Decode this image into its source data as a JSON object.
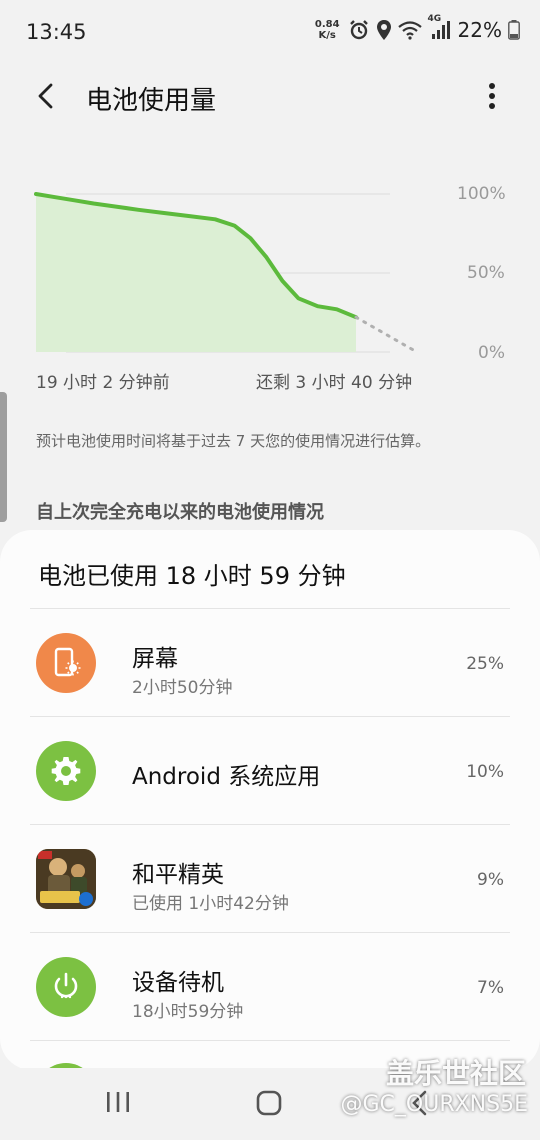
{
  "status_bar": {
    "time": "13:45",
    "net_speed_value": "0.84",
    "net_speed_unit": "K/s",
    "network_type": "4G",
    "battery": "22%",
    "icons": [
      "alarm-icon",
      "location-icon",
      "wifi-icon",
      "signal-icon",
      "battery-icon"
    ]
  },
  "header": {
    "title": "电池使用量",
    "back_icon": "chevron-left-icon",
    "more_icon": "more-vertical-icon"
  },
  "battery_chart": {
    "type": "area",
    "ticks": [
      "100%",
      "50%",
      "0%"
    ],
    "ylim": [
      0,
      100
    ],
    "x_start_label": "19 小时 2 分钟前",
    "x_end_label": "还剩 3 小时 40 分钟",
    "line_color": "#5cba3c",
    "fill_color": "#dcefd4",
    "history": [
      [
        0,
        100
      ],
      [
        0.06,
        98
      ],
      [
        0.12,
        96
      ],
      [
        0.18,
        94
      ],
      [
        0.25,
        92
      ],
      [
        0.32,
        90
      ],
      [
        0.4,
        88
      ],
      [
        0.48,
        86
      ],
      [
        0.56,
        84
      ],
      [
        0.62,
        80
      ],
      [
        0.67,
        72
      ],
      [
        0.72,
        60
      ],
      [
        0.77,
        45
      ],
      [
        0.82,
        34
      ],
      [
        0.88,
        29
      ],
      [
        0.94,
        27
      ],
      [
        1.0,
        22
      ]
    ],
    "projection": [
      [
        1.0,
        22
      ],
      [
        1.19,
        0
      ]
    ]
  },
  "estimate_note": "预计电池使用时间将基于过去 7 天您的使用情况进行估算。",
  "section_header": "自上次完全充电以来的电池使用情况",
  "usage": {
    "summary": "电池已使用 18 小时 59 分钟",
    "apps": [
      {
        "name": "屏幕",
        "detail": "2小时50分钟",
        "percent": "25%",
        "icon": "screen-brightness-icon",
        "color": "#f0884a"
      },
      {
        "name": "Android 系统应用",
        "detail": "",
        "percent": "10%",
        "icon": "gear-icon",
        "color": "#7cc142"
      },
      {
        "name": "和平精英",
        "detail": "已使用 1小时42分钟",
        "percent": "9%",
        "icon": "game-app-icon",
        "color": "#7a5a2a"
      },
      {
        "name": "设备待机",
        "detail": "18小时59分钟",
        "percent": "7%",
        "icon": "power-icon",
        "color": "#7cc142"
      }
    ]
  },
  "nav": {
    "recent_icon": "recent-apps-icon",
    "home_icon": "home-icon",
    "back_icon": "back-icon"
  },
  "watermark": {
    "site": "盖乐世社区",
    "handle": "@GC_OURXNS5E"
  }
}
